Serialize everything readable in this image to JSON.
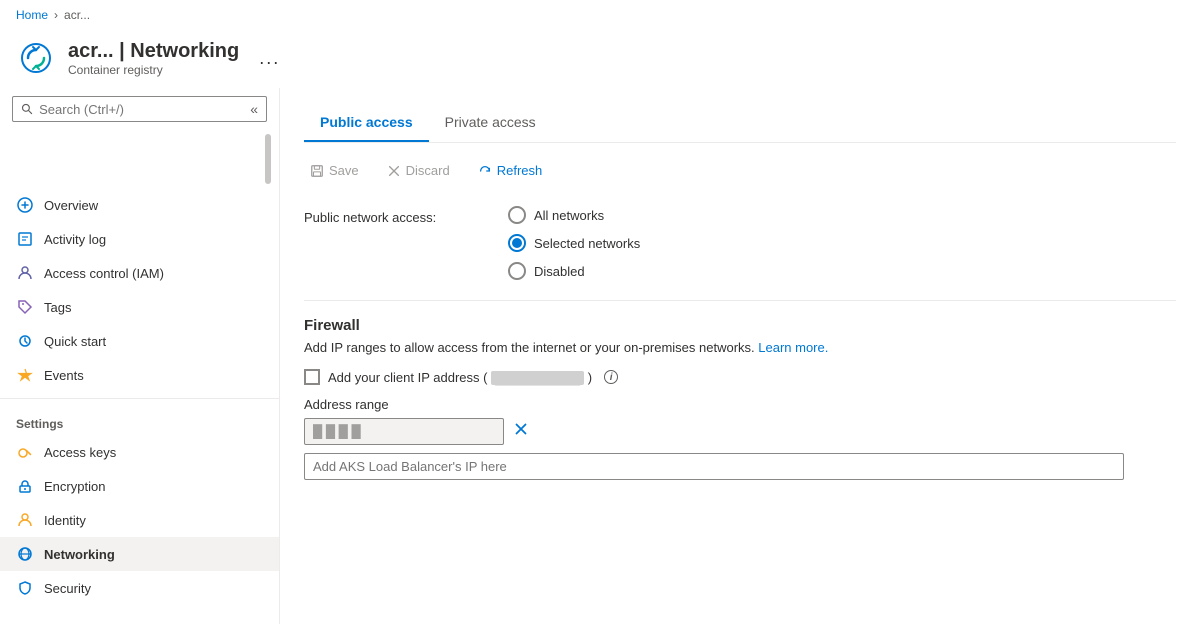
{
  "breadcrumb": {
    "home": "Home",
    "resource": "acr..."
  },
  "header": {
    "title": "acr... | Networking",
    "subtitle": "Container registry",
    "more_label": "..."
  },
  "sidebar": {
    "search_placeholder": "Search (Ctrl+/)",
    "collapse_label": "«",
    "items": [
      {
        "id": "overview",
        "label": "Overview",
        "icon": "overview"
      },
      {
        "id": "activity-log",
        "label": "Activity log",
        "icon": "activity"
      },
      {
        "id": "access-control",
        "label": "Access control (IAM)",
        "icon": "iam"
      },
      {
        "id": "tags",
        "label": "Tags",
        "icon": "tags"
      },
      {
        "id": "quick-start",
        "label": "Quick start",
        "icon": "quickstart"
      },
      {
        "id": "events",
        "label": "Events",
        "icon": "events"
      }
    ],
    "settings_label": "Settings",
    "settings_items": [
      {
        "id": "access-keys",
        "label": "Access keys",
        "icon": "key"
      },
      {
        "id": "encryption",
        "label": "Encryption",
        "icon": "encryption"
      },
      {
        "id": "identity",
        "label": "Identity",
        "icon": "identity"
      },
      {
        "id": "networking",
        "label": "Networking",
        "icon": "networking",
        "active": true
      },
      {
        "id": "security",
        "label": "Security",
        "icon": "security"
      }
    ]
  },
  "tabs": [
    {
      "id": "public-access",
      "label": "Public access",
      "active": true
    },
    {
      "id": "private-access",
      "label": "Private access",
      "active": false
    }
  ],
  "toolbar": {
    "save_label": "Save",
    "discard_label": "Discard",
    "refresh_label": "Refresh"
  },
  "public_network_access": {
    "label": "Public network access:",
    "options": [
      {
        "id": "all",
        "label": "All networks",
        "selected": false
      },
      {
        "id": "selected",
        "label": "Selected networks",
        "selected": true
      },
      {
        "id": "disabled",
        "label": "Disabled",
        "selected": false
      }
    ]
  },
  "firewall": {
    "heading": "Firewall",
    "description": "Add IP ranges to allow access from the internet or your on-premises networks.",
    "learn_more": "Learn more.",
    "checkbox_label": "Add your client IP address (",
    "ip_placeholder": "██████████",
    "ip_suffix": ")",
    "address_range_label": "Address range",
    "address_range_value": "█ █ █ █",
    "add_balancer_placeholder": "Add AKS Load Balancer's IP here"
  }
}
